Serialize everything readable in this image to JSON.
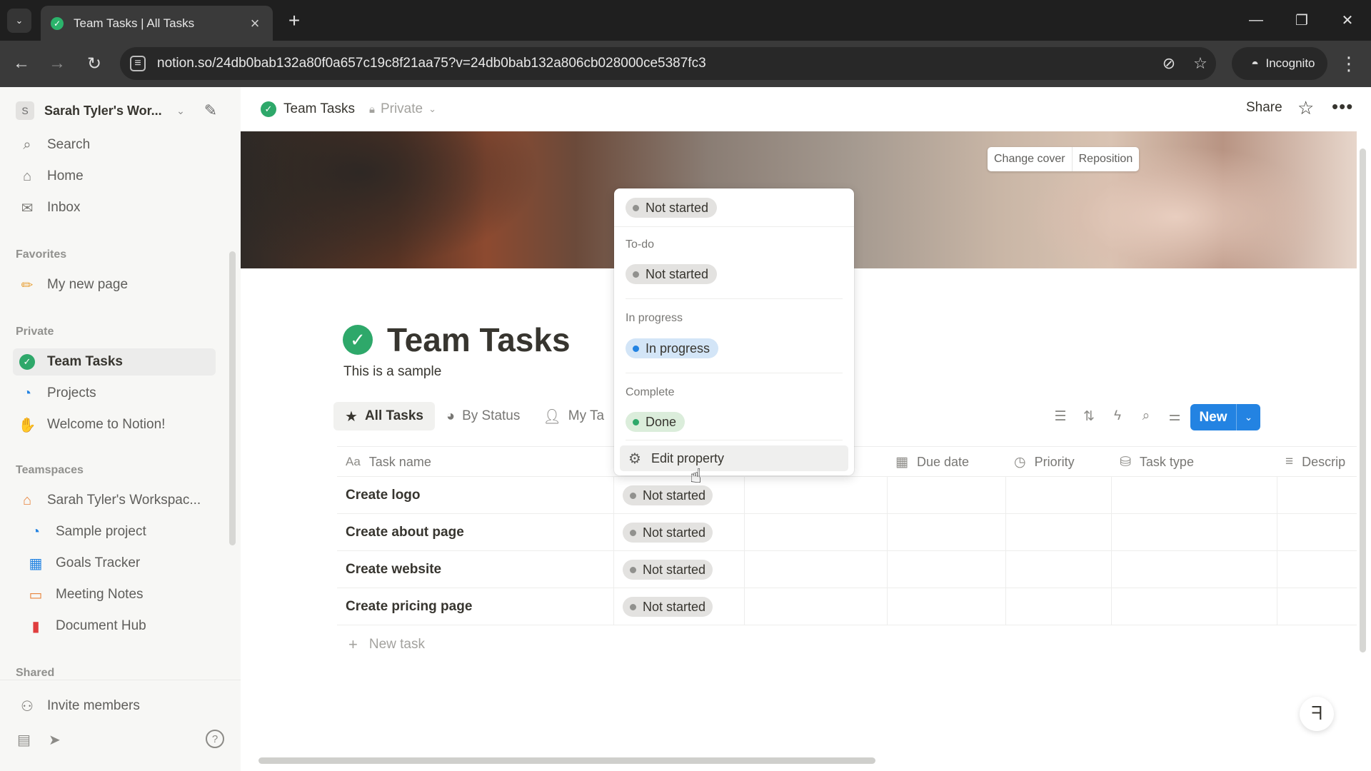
{
  "browser": {
    "tab_title": "Team Tasks | All Tasks",
    "url": "notion.so/24db0bab132a80f0a657c19c8f21aa75?v=24db0bab132a806cb028000ce5387fc3",
    "incognito_label": "Incognito"
  },
  "sidebar": {
    "workspace_initial": "S",
    "workspace_name": "Sarah Tyler's Wor...",
    "top_items": [
      {
        "label": "Search",
        "icon": "search-icon"
      },
      {
        "label": "Home",
        "icon": "home-icon"
      },
      {
        "label": "Inbox",
        "icon": "inbox-icon"
      }
    ],
    "favorites_label": "Favorites",
    "favorites": [
      {
        "label": "My new page",
        "icon": "pencil-icon"
      }
    ],
    "private_label": "Private",
    "private": [
      {
        "label": "Team Tasks",
        "icon": "check-circle-icon"
      },
      {
        "label": "Projects",
        "icon": "projects-icon"
      },
      {
        "label": "Welcome to Notion!",
        "icon": "wave-icon"
      }
    ],
    "teamspaces_label": "Teamspaces",
    "teamspaces": [
      {
        "label": "Sarah Tyler's Workspac...",
        "icon": "house-icon"
      },
      {
        "label": "Sample project",
        "icon": "projects-icon"
      },
      {
        "label": "Goals Tracker",
        "icon": "chart-icon"
      },
      {
        "label": "Meeting Notes",
        "icon": "calendar-icon"
      },
      {
        "label": "Document Hub",
        "icon": "document-icon"
      }
    ],
    "shared_label": "Shared",
    "invite_label": "Invite members"
  },
  "topbar": {
    "crumb_title": "Team Tasks",
    "privacy": "Private",
    "share_label": "Share"
  },
  "cover": {
    "change_label": "Change cover",
    "reposition_label": "Reposition"
  },
  "page": {
    "title": "Team Tasks",
    "description": "This is a sample"
  },
  "views": [
    {
      "label": "All Tasks",
      "icon": "star-icon"
    },
    {
      "label": "By Status",
      "icon": "status-icon"
    },
    {
      "label": "My Ta",
      "icon": "person-icon"
    }
  ],
  "new_button_label": "New",
  "table": {
    "columns": [
      {
        "label": "Task name",
        "icon": "Aa"
      },
      {
        "label": "Due date",
        "icon": "calendar-icon"
      },
      {
        "label": "Priority",
        "icon": "priority-icon"
      },
      {
        "label": "Task type",
        "icon": "tasktype-icon"
      },
      {
        "label": "Descrip",
        "icon": "lines-icon"
      }
    ],
    "rows": [
      {
        "name": "Create logo",
        "status": "Not started"
      },
      {
        "name": "Create about page",
        "status": "Not started"
      },
      {
        "name": "Create website",
        "status": "Not started"
      },
      {
        "name": "Create pricing page",
        "status": "Not started"
      }
    ],
    "new_task_label": "New task"
  },
  "status_dropdown": {
    "current": "Not started",
    "groups": [
      {
        "label": "To-do",
        "option": "Not started",
        "color": "#91918e"
      },
      {
        "label": "In progress",
        "option": "In progress",
        "color": "#2383e2"
      },
      {
        "label": "Complete",
        "option": "Done",
        "color": "#2ea86a"
      }
    ],
    "edit_label": "Edit property"
  }
}
